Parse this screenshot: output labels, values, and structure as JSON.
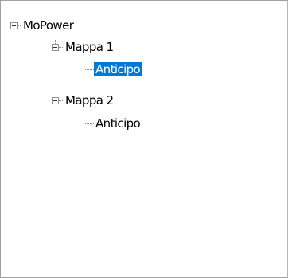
{
  "tree": {
    "root": {
      "label": "MoPower",
      "expanded": true,
      "children": [
        {
          "label": "Mappa 1",
          "expanded": true,
          "children": [
            {
              "label": "Anticipo",
              "selected": true
            }
          ]
        },
        {
          "label": "Mappa 2",
          "expanded": true,
          "children": [
            {
              "label": "Anticipo",
              "selected": false
            }
          ]
        }
      ]
    }
  },
  "colors": {
    "selection_background": "#0078d7",
    "selection_text": "#ffffff",
    "border": "#a0a0a0"
  }
}
